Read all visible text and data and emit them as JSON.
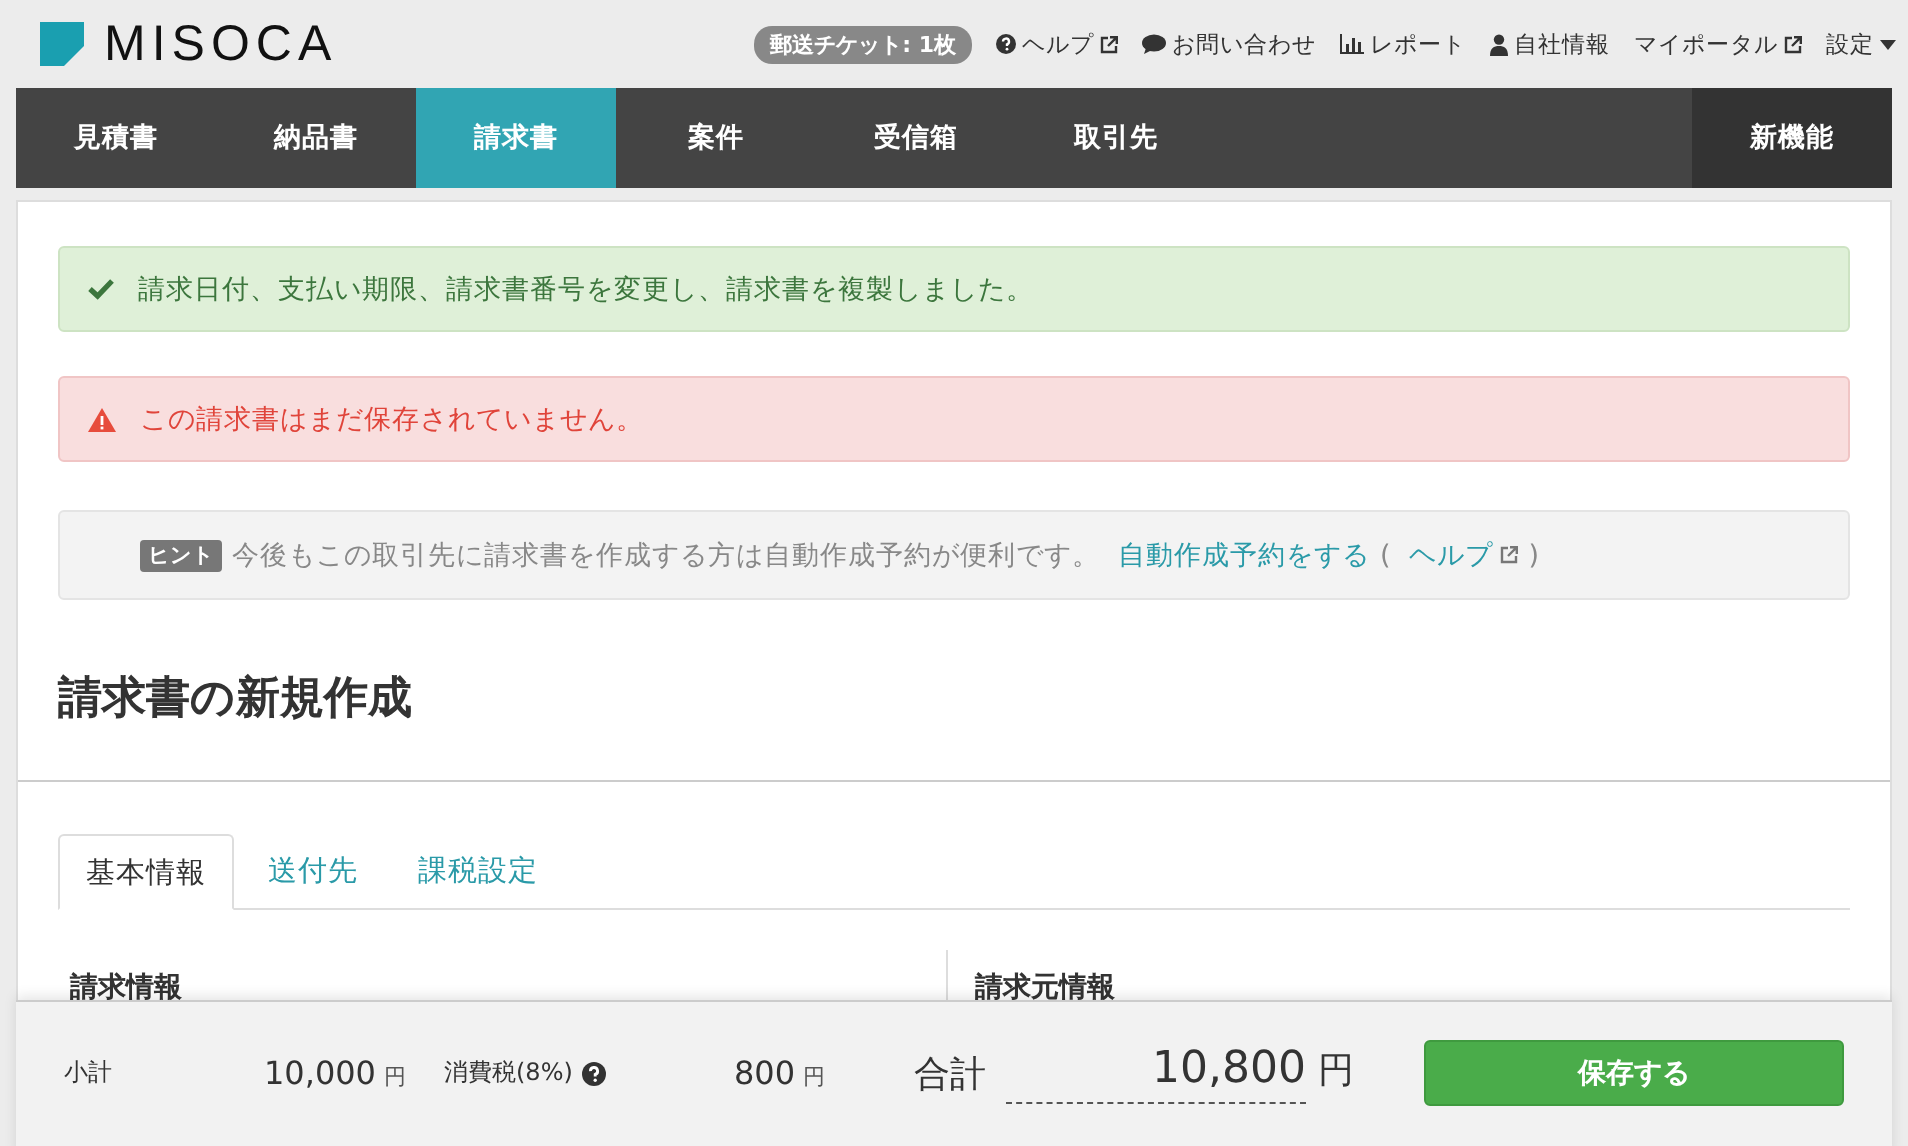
{
  "header": {
    "logo": "MISOCA",
    "ticket_badge": "郵送チケット: 1枚",
    "links": [
      {
        "kind": "help",
        "label": "ヘルプ",
        "external": true
      },
      {
        "kind": "chat",
        "label": "お問い合わせ",
        "external": false
      },
      {
        "kind": "chart",
        "label": "レポート",
        "external": false
      },
      {
        "kind": "person",
        "label": "自社情報",
        "external": false
      },
      {
        "kind": "none",
        "label": "マイポータル",
        "external": true
      }
    ],
    "settings": "設定"
  },
  "nav": [
    {
      "label": "見積書",
      "selected": false
    },
    {
      "label": "納品書",
      "selected": false
    },
    {
      "label": "請求書",
      "selected": true
    },
    {
      "label": "案件",
      "selected": false
    },
    {
      "label": "受信箱",
      "selected": false
    },
    {
      "label": "取引先",
      "selected": false
    }
  ],
  "nav_feature": "新機能",
  "messages": [
    {
      "kind": "success",
      "text": "請求日付、支払い期限、請求書番号を変更し、請求書を複製しました。"
    },
    {
      "kind": "danger",
      "text": "この請求書はまだ保存されていません。"
    }
  ],
  "hint": {
    "badge": "ヒント",
    "text": "今後もこの取引先に請求書を作成する方は自動作成予約が便利です。",
    "link": "自動作成予約をする",
    "open_paren": "(",
    "help_link": "ヘルプ",
    "close_paren": ")"
  },
  "page_title": "請求書の新規作成",
  "tabs": [
    {
      "label": "基本情報",
      "selected": true
    },
    {
      "label": "送付先",
      "selected": false
    },
    {
      "label": "課税設定",
      "selected": false
    }
  ],
  "sections": [
    "請求情報",
    "請求元情報"
  ],
  "footer": {
    "subtotal_label": "小計",
    "subtotal": "10,000",
    "subtotal_unit": "円",
    "tax_label": "消費税(8%)",
    "tax": "800",
    "tax_unit": "円",
    "total_label": "合計",
    "total": "10,800",
    "total_unit": "円",
    "save_button": "保存する"
  }
}
